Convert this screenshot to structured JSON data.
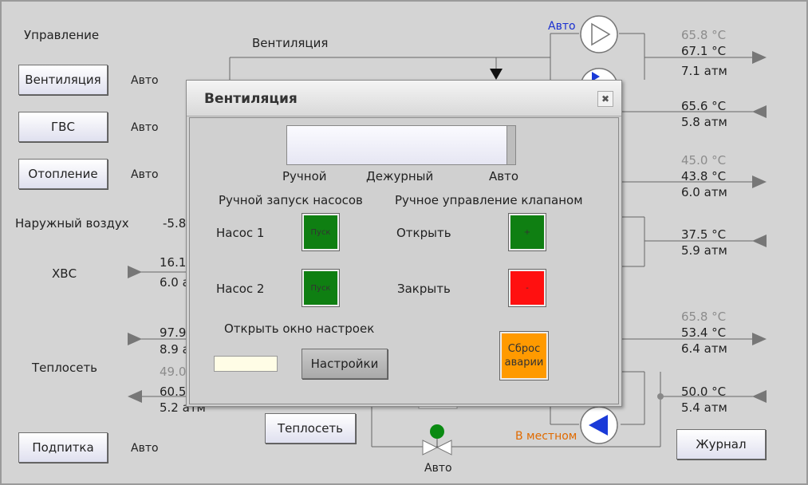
{
  "main": {
    "title": "Управление",
    "ventilation_label": "Вентиляция",
    "auto": "Авто",
    "buttons": {
      "ventilation": "Вентиляция",
      "gvs": "ГВС",
      "heating": "Отопление",
      "makeup": "Подпитка",
      "heatnet": "Теплосеть",
      "journal": "Журнал"
    },
    "outdoor_air_label": "Наружный воздух",
    "outdoor_air_value": "-5.8",
    "hvs_label": "ХВС",
    "hvs_temp": "16.1",
    "hvs_press": "6.0 а",
    "net_in_temp": "97.9",
    "net_in_press": "8.9 а",
    "heatnet_label": "Теплосеть",
    "net_gray": "49.0",
    "net_out_temp": "60.5",
    "net_out_press": "5.2 атм",
    "pump_top_mode": "Авто",
    "pump_bottom_mode": "В местном",
    "valve_mode": "Авто",
    "right": [
      {
        "gray": "65.8 °C",
        "temp": "67.1 °C",
        "press": "7.1 атм"
      },
      {
        "gray": "",
        "temp": "65.6 °C",
        "press": "5.8 атм"
      },
      {
        "gray": "45.0 °C",
        "temp": "43.8 °C",
        "press": "6.0 атм"
      },
      {
        "gray": "",
        "temp": "37.5 °C",
        "press": "5.9 атм"
      },
      {
        "gray": "65.8 °C",
        "temp": "53.4 °C",
        "press": "6.4 атм"
      },
      {
        "gray": "",
        "temp": "50.0 °C",
        "press": "5.4 атм"
      }
    ]
  },
  "modal": {
    "title": "Вентиляция",
    "close_icon": "close-icon",
    "mode_manual": "Ручной",
    "mode_duty": "Дежурный",
    "mode_auto": "Авто",
    "pumps_header": "Ручной запуск насосов",
    "valve_header": "Ручное управление клапаном",
    "pump1": "Насос 1",
    "pump2": "Насос 2",
    "start": "Пуск",
    "open": "Открыть",
    "close": "Закрыть",
    "plus": "+",
    "minus": "-",
    "settings_header": "Открыть окно настроек",
    "settings_btn": "Настройки",
    "reset_line1": "Сброс",
    "reset_line2": "аварии"
  },
  "colors": {
    "start_green": "#0f7f12",
    "stop_red": "#ff1010",
    "reset_orange": "#ff9a00",
    "auto_blue": "#1a2fd0",
    "local_orange": "#e06a00"
  }
}
